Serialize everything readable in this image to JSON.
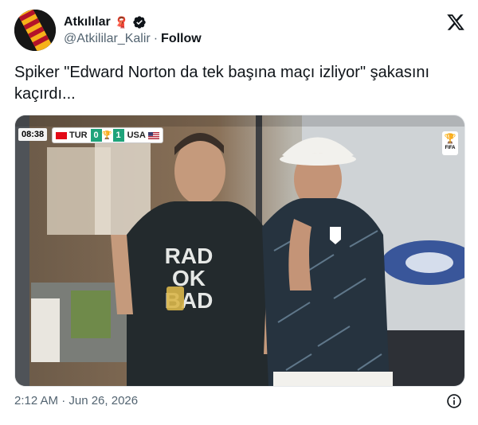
{
  "author": {
    "display_name": "Atkılılar",
    "handle": "@Atkililar_Kalir",
    "separator": "·",
    "follow_label": "Follow",
    "name_emoji": "🧣"
  },
  "tweet": {
    "text": "Spiker \"Edward Norton da tek başına maçı izliyor\" şakasını kaçırdı..."
  },
  "scoreboard": {
    "clock": "08:38",
    "home_team": "TUR",
    "home_score": "0",
    "away_score": "1",
    "away_team": "USA",
    "broadcaster_badge": "FIFA"
  },
  "shirt_print": {
    "line1": "RAD",
    "line2": "OK",
    "line3": "BAD"
  },
  "footer": {
    "timestamp": "2:12 AM · Jun 26, 2026"
  },
  "colors": {
    "score_green": "#1fa37a",
    "verified_badge": "#0f1419",
    "secondary_text": "#536471"
  },
  "icons": {
    "x_logo": "x-logo-icon",
    "verified": "verified-badge-icon",
    "info": "info-icon"
  }
}
